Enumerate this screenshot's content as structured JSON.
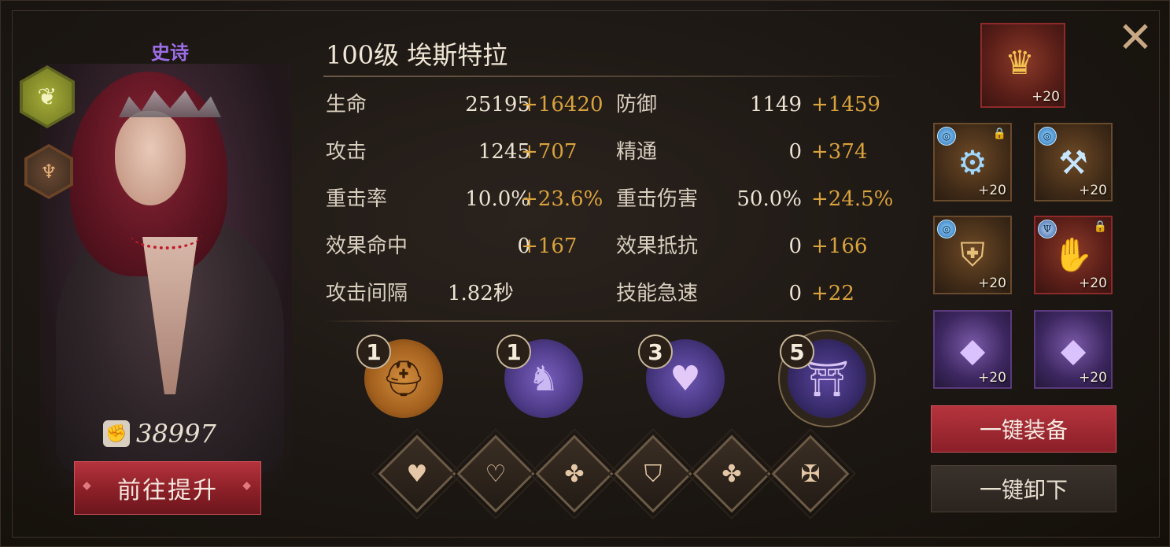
{
  "hero": {
    "rarity": "史诗",
    "title": "100级  埃斯特拉",
    "power": "38997",
    "upgrade_button": "前往提升"
  },
  "stats_left": [
    {
      "label": "生命",
      "base": "25195",
      "bonus": "+16420"
    },
    {
      "label": "攻击",
      "base": "1245",
      "bonus": "+707"
    },
    {
      "label": "重击率",
      "base": "10.0%",
      "bonus": "+23.6%"
    },
    {
      "label": "效果命中",
      "base": "0",
      "bonus": "+167"
    },
    {
      "label": "攻击间隔",
      "base": "1.82秒",
      "bonus": ""
    }
  ],
  "stats_right": [
    {
      "label": "防御",
      "base": "1149",
      "bonus": "+1459"
    },
    {
      "label": "精通",
      "base": "0",
      "bonus": "+374"
    },
    {
      "label": "重击伤害",
      "base": "50.0%",
      "bonus": "+24.5%"
    },
    {
      "label": "效果抵抗",
      "base": "0",
      "bonus": "+166"
    },
    {
      "label": "技能急速",
      "base": "0",
      "bonus": "+22"
    }
  ],
  "set_medals": [
    {
      "count": "1",
      "icon": "spartan-helmet-icon"
    },
    {
      "count": "1",
      "icon": "armored-knight-icon"
    },
    {
      "count": "3",
      "icon": "heart-shield-icon"
    },
    {
      "count": "5",
      "icon": "heart-gate-icon"
    }
  ],
  "skill_slots": [
    {
      "icon": "heart-icon"
    },
    {
      "icon": "heart-hand-icon"
    },
    {
      "icon": "leaf-plus-icon"
    },
    {
      "icon": "shield-icon"
    },
    {
      "icon": "leaf-plus-icon"
    },
    {
      "icon": "cross-hammer-icon"
    }
  ],
  "equipment": {
    "crown": {
      "level": "+20",
      "icon": "antler-crown-icon"
    },
    "slots": [
      {
        "level": "+20",
        "icon": "bracer-icon"
      },
      {
        "level": "+20",
        "icon": "hammer-icon"
      },
      {
        "level": "+20",
        "icon": "chest-armor-icon"
      },
      {
        "level": "+20",
        "icon": "gauntlet-icon"
      },
      {
        "level": "+20",
        "icon": "purple-gem-icon"
      },
      {
        "level": "+20",
        "icon": "purple-gem-icon"
      }
    ],
    "equip_all_button": "一键装备",
    "unequip_all_button": "一键卸下"
  }
}
